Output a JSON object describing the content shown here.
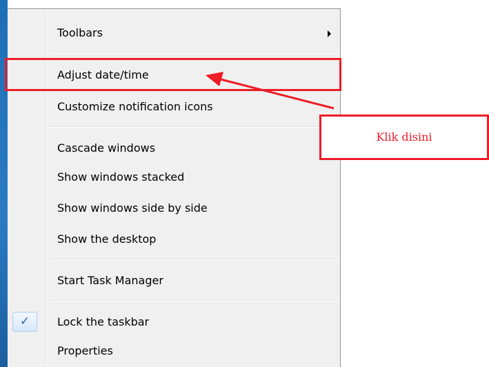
{
  "context_menu": {
    "items": [
      {
        "label": "Toolbars",
        "has_submenu": true
      },
      {
        "label": "Adjust date/time"
      },
      {
        "label": "Customize notification icons"
      },
      {
        "label": "Cascade windows"
      },
      {
        "label": "Show windows stacked"
      },
      {
        "label": "Show windows side by side"
      },
      {
        "label": "Show the desktop"
      },
      {
        "label": "Start Task Manager"
      },
      {
        "label": "Lock the taskbar",
        "checked": true
      },
      {
        "label": "Properties"
      }
    ]
  },
  "annotation": {
    "callout_text": "Klik disini",
    "highlight_color": "#ee1c25"
  }
}
